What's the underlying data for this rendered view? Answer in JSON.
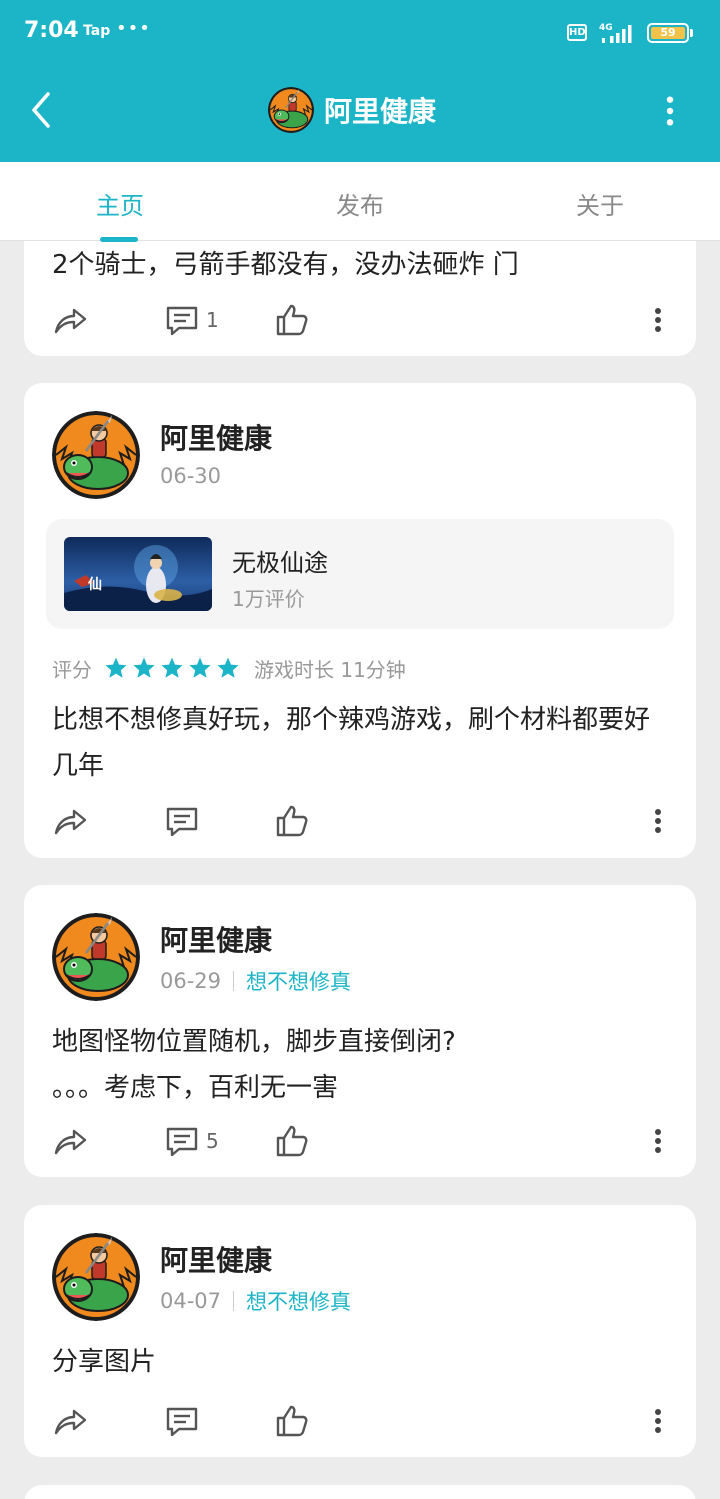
{
  "status_bar": {
    "time": "7:04",
    "app_indicator": "Tap",
    "dots": "•••",
    "hd": "HD",
    "network": "4G",
    "battery": "59",
    "battery_color": "#f2c34b"
  },
  "header": {
    "title": "阿里健康",
    "accent_color": "#1cb5c7",
    "back_icon": "chevron-left-icon",
    "more_icon": "more-vertical-icon"
  },
  "tabs": [
    {
      "label": "主页",
      "active": true
    },
    {
      "label": "发布",
      "active": false
    },
    {
      "label": "关于",
      "active": false
    }
  ],
  "posts": [
    {
      "partial": true,
      "text": "2个骑士，弓箭手都没有，没办法砸炸 门",
      "comments": "1",
      "likes": ""
    },
    {
      "author": "阿里健康",
      "date": "06-30",
      "game": {
        "name": "无极仙途",
        "reviews": "1万评价"
      },
      "rating_label": "评分",
      "rating": 5,
      "playtime": "游戏时长 11分钟",
      "text": "比想不想修真好玩，那个辣鸡游戏，刷个材料都要好几年",
      "comments": "",
      "likes": ""
    },
    {
      "author": "阿里健康",
      "date": "06-29",
      "game_tag": "想不想修真",
      "text_line1": "地图怪物位置随机，脚步直接倒闭?",
      "text_line2": "。。。考虑下，百利无一害",
      "comments": "5",
      "likes": ""
    },
    {
      "author": "阿里健康",
      "date": "04-07",
      "game_tag": "想不想修真",
      "text": "分享图片",
      "comments": "",
      "likes": ""
    }
  ]
}
